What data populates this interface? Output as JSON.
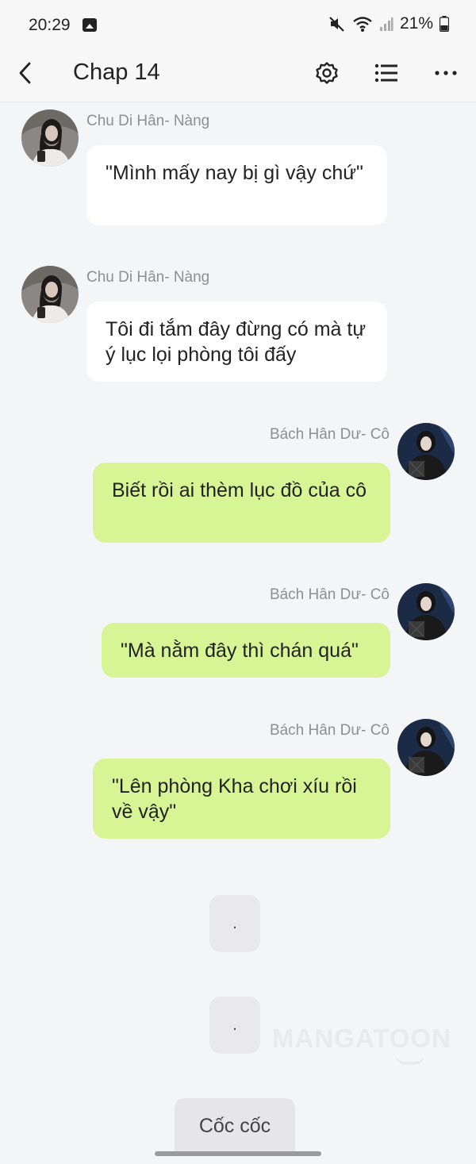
{
  "status_bar": {
    "time": "20:29",
    "battery": "21%",
    "icons": [
      "gallery-icon",
      "mute-icon",
      "wifi-icon",
      "signal-icon",
      "battery-icon"
    ]
  },
  "header": {
    "title": "Chap 14",
    "icons": [
      "back-arrow-icon",
      "settings-gear-icon",
      "list-icon",
      "more-dots-icon"
    ]
  },
  "messages": [
    {
      "side": "left",
      "sender": "Chu Di Hân- Nàng",
      "text": "\"Mình mấy nay bị gì vậy chứ\""
    },
    {
      "side": "left",
      "sender": "Chu Di Hân- Nàng",
      "text": "Tôi đi tắm đây đừng có mà tự ý lục lọi phòng tôi đấy"
    },
    {
      "side": "right",
      "sender": "Bách Hân Dư- Cô",
      "text": "Biết rồi ai thèm lục đồ của cô"
    },
    {
      "side": "right",
      "sender": "Bách Hân Dư- Cô",
      "text": "\"Mà nằm đây thì chán quá\""
    },
    {
      "side": "right",
      "sender": "Bách Hân Dư- Cô",
      "text": "\"Lên phòng Kha chơi xíu rồi về vậy\""
    }
  ],
  "narration": [
    ".",
    "."
  ],
  "watermark": "MANGATOON",
  "action_button": "Cốc cốc",
  "colors": {
    "background": "#f4f5f7",
    "left_bubble": "#ffffff",
    "right_bubble": "#d8f595",
    "sender_text": "#8e8e93"
  }
}
